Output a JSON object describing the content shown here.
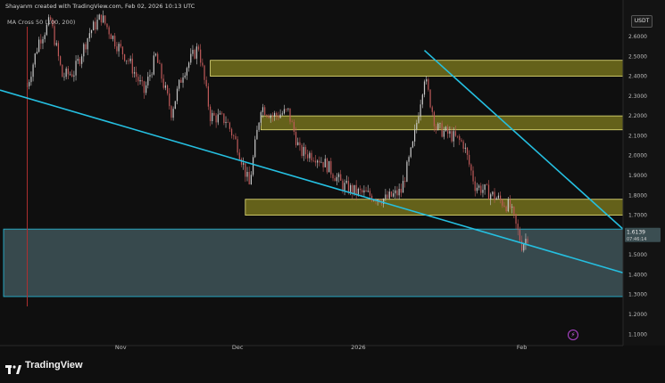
{
  "header": {
    "attribution": "Shayanm created with TradingView.com, Feb 02, 2026 10:13 UTC",
    "indicator": "MA Cross 50 (100, 200)",
    "currency": "USDT"
  },
  "branding": {
    "logo_text": "TradingView"
  },
  "colors": {
    "background": "#0f0f0f",
    "zone_fill": "#6e6a1c",
    "zone_border": "#e9e37a",
    "support_fill": "#3e5358",
    "trendline": "#25bfe0",
    "bull": "#c9c9c9",
    "bear": "#c05a5a",
    "vertical_marker": "#b03030",
    "flash": "#b046d0"
  },
  "chart_data": {
    "type": "candlestick",
    "x_ticks": [
      "Nov",
      "Dec",
      "2026",
      "Feb"
    ],
    "y_ticks": [
      "2.6000",
      "2.5000",
      "2.4000",
      "2.3000",
      "2.2000",
      "2.1000",
      "2.0000",
      "1.9000",
      "1.8000",
      "1.7000",
      "1.6000",
      "1.5000",
      "1.4000",
      "1.3000",
      "1.2000",
      "1.1000"
    ],
    "ylim": [
      1.07,
      2.73
    ],
    "last_price": "1.6139",
    "last_price_sub": "07:46:14",
    "price_path": [
      [
        "2025-10-08",
        2.35
      ],
      [
        "2025-10-11",
        2.58
      ],
      [
        "2025-10-14",
        2.68
      ],
      [
        "2025-10-17",
        2.4
      ],
      [
        "2025-10-20",
        2.42
      ],
      [
        "2025-10-24",
        2.62
      ],
      [
        "2025-10-27",
        2.7
      ],
      [
        "2025-10-31",
        2.56
      ],
      [
        "2025-11-03",
        2.48
      ],
      [
        "2025-11-07",
        2.32
      ],
      [
        "2025-11-10",
        2.5
      ],
      [
        "2025-11-14",
        2.22
      ],
      [
        "2025-11-17",
        2.42
      ],
      [
        "2025-11-21",
        2.55
      ],
      [
        "2025-11-24",
        2.2
      ],
      [
        "2025-11-28",
        2.18
      ],
      [
        "2025-12-01",
        2.05
      ],
      [
        "2025-12-04",
        1.85
      ],
      [
        "2025-12-07",
        2.25
      ],
      [
        "2025-12-10",
        2.2
      ],
      [
        "2025-12-14",
        2.22
      ],
      [
        "2025-12-17",
        2.02
      ],
      [
        "2025-12-21",
        2.0
      ],
      [
        "2025-12-24",
        1.95
      ],
      [
        "2025-12-28",
        1.85
      ],
      [
        "2025-12-31",
        1.82
      ],
      [
        "2026-01-04",
        1.8
      ],
      [
        "2026-01-08",
        1.78
      ],
      [
        "2026-01-12",
        1.82
      ],
      [
        "2026-01-15",
        2.05
      ],
      [
        "2026-01-18",
        2.4
      ],
      [
        "2026-01-21",
        2.14
      ],
      [
        "2026-01-25",
        2.1
      ],
      [
        "2026-01-28",
        2.06
      ],
      [
        "2026-01-31",
        1.85
      ],
      [
        "2026-02-03",
        1.82
      ],
      [
        "2026-02-06",
        1.78
      ],
      [
        "2026-02-09",
        1.74
      ],
      [
        "2026-02-12",
        1.55
      ],
      [
        "2026-02-14",
        1.61
      ]
    ],
    "zones": [
      {
        "from": "2025-11-24",
        "to": "2026-03-10",
        "low": 2.4,
        "high": 2.48
      },
      {
        "from": "2025-12-07",
        "to": "2026-03-10",
        "low": 2.13,
        "high": 2.2
      },
      {
        "from": "2025-12-03",
        "to": "2026-03-10",
        "low": 1.7,
        "high": 1.78
      }
    ],
    "support_zone": {
      "low": 1.29,
      "high": 1.63
    },
    "trendlines": [
      {
        "from": [
          "2025-10-01",
          2.33
        ],
        "to": [
          "2026-03-10",
          1.41
        ]
      },
      {
        "from": [
          "2026-01-18",
          2.53
        ],
        "to": [
          "2026-03-10",
          1.63
        ]
      }
    ],
    "vertical_marker": "2025-10-08",
    "grid": false
  }
}
